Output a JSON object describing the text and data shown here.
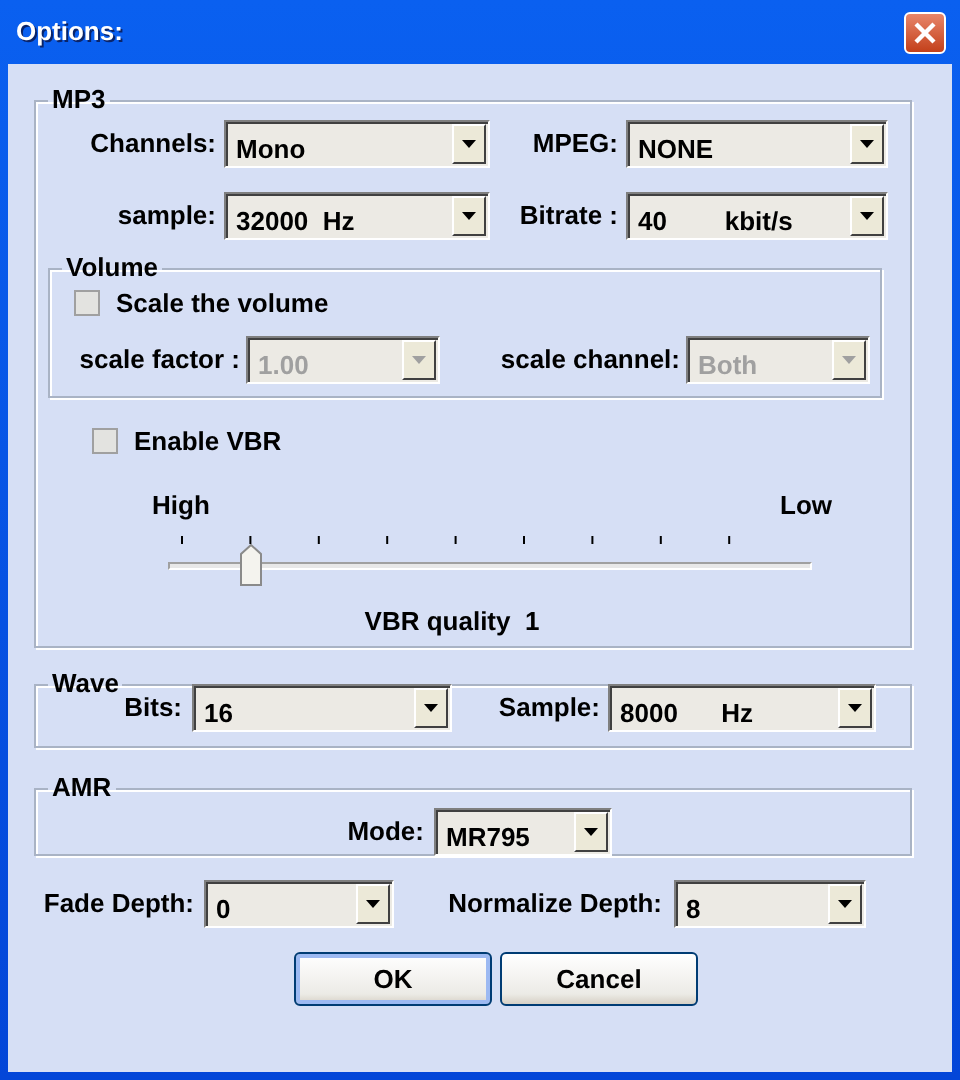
{
  "window": {
    "title": "Options:"
  },
  "mp3": {
    "label": "MP3",
    "rows": [
      [
        {
          "label": "Channels:",
          "value": "Mono"
        },
        {
          "label": "MPEG:",
          "value": "NONE"
        }
      ],
      [
        {
          "label": "sample:",
          "value": "32000  Hz"
        },
        {
          "label": "Bitrate :",
          "value": "40        kbit/s"
        }
      ]
    ],
    "volume": {
      "label": "Volume",
      "checkbox": {
        "label": "Scale the volume",
        "checked": false
      },
      "fields": [
        {
          "label": "scale factor :",
          "value": "1.00",
          "disabled": true
        },
        {
          "label": "scale channel:",
          "value": "Both",
          "disabled": true
        }
      ]
    },
    "vbr": {
      "label": "Enable VBR",
      "checked": false
    },
    "slider": {
      "left_label": "High",
      "right_label": "Low",
      "level": 0.111,
      "caption": "VBR quality  1"
    }
  },
  "wave": {
    "label": "Wave",
    "fields": [
      {
        "label": "Bits:",
        "value": "16"
      },
      {
        "label": "Sample:",
        "value": "8000      Hz"
      }
    ]
  },
  "amr": {
    "label": "AMR",
    "fields": [
      {
        "label": "Mode:",
        "value": "MR795"
      }
    ]
  },
  "bottom_fields": [
    {
      "label": "Fade Depth:",
      "value": "0"
    },
    {
      "label": "Normalize Depth:",
      "value": "8"
    }
  ],
  "buttons": [
    {
      "label": "OK",
      "default": true
    },
    {
      "label": "Cancel",
      "default": false
    }
  ]
}
